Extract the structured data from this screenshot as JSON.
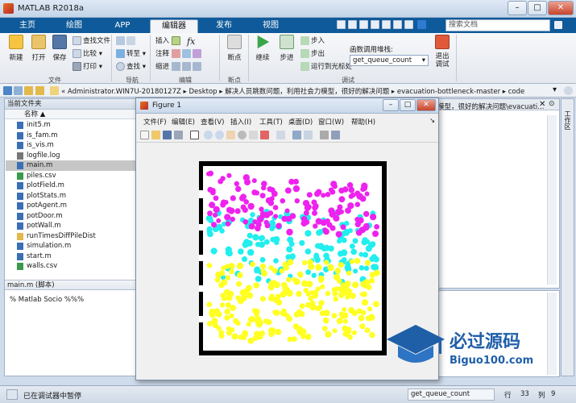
{
  "app": {
    "title": "MATLAB R2018a"
  },
  "ribbon": {
    "tabs": [
      "主页",
      "绘图",
      "APP",
      "编辑器",
      "发布",
      "视图"
    ],
    "active_tab": "编辑器",
    "search_placeholder": "搜索文档"
  },
  "toolstrip": {
    "file": {
      "new": "新建",
      "open": "打开",
      "save": "保存",
      "find_files": "查找文件",
      "compare": "比较",
      "print": "打印",
      "group": "文件"
    },
    "navigate": {
      "goto": "转至",
      "find": "查找",
      "group": "导航"
    },
    "edit": {
      "insert": "插入",
      "comment": "注释",
      "indent": "缩进",
      "fx": "fx",
      "group": "编辑"
    },
    "breakpoints": {
      "label": "断点",
      "group": "断点"
    },
    "debug": {
      "continue": "继续",
      "step": "步进",
      "step_in": "步入",
      "step_out": "步出",
      "run_to_cursor": "运行到光标处",
      "stack_label": "函数调用堆栈:",
      "stack_value": "get_queue_count",
      "quit": "退出\n调试",
      "group": "调试"
    }
  },
  "address": {
    "path": "« Administrator.WIN7U-20180127Z  ▸  Desktop  ▸  解决人员跳数问题，利用社会力模型，很好的解决问题  ▸  evacuation-bottleneck-master  ▸  code"
  },
  "current_folder": {
    "title": "当前文件夹",
    "column": "名称 ▲",
    "files": [
      {
        "name": "init5.m",
        "type": "m"
      },
      {
        "name": "is_fam.m",
        "type": "m"
      },
      {
        "name": "is_vis.m",
        "type": "m"
      },
      {
        "name": "logfile.log",
        "type": "log"
      },
      {
        "name": "main.m",
        "type": "m",
        "selected": true
      },
      {
        "name": "piles.csv",
        "type": "csv"
      },
      {
        "name": "plotField.m",
        "type": "m"
      },
      {
        "name": "plotStats.m",
        "type": "m"
      },
      {
        "name": "potAgent.m",
        "type": "m"
      },
      {
        "name": "potDoor.m",
        "type": "m"
      },
      {
        "name": "potWall.m",
        "type": "m"
      },
      {
        "name": "runTimesDiffPileDist",
        "type": "folder"
      },
      {
        "name": "simulation.m",
        "type": "m"
      },
      {
        "name": "start.m",
        "type": "m"
      },
      {
        "name": "walls.csv",
        "type": "csv"
      }
    ],
    "details_title": "main.m  (脚本)",
    "details_text": "% Matlab Socio %%%"
  },
  "editor": {
    "tab_text": "模型，很好的解决问题\\evacuati..."
  },
  "figure": {
    "title": "Figure 1",
    "menu": [
      "文件(F)",
      "编辑(E)",
      "查看(V)",
      "插入(I)",
      "工具(T)",
      "桌面(D)",
      "窗口(W)",
      "帮助(H)"
    ],
    "colors": {
      "magenta": "#ee22ee",
      "cyan": "#22eeee",
      "yellow": "#ffff22",
      "wall": "#000000"
    },
    "plot_regions": [
      {
        "color": "magenta",
        "region": "top",
        "count": 140
      },
      {
        "color": "cyan",
        "region": "middle",
        "count": 150
      },
      {
        "color": "yellow",
        "region": "bottom",
        "count": 230
      }
    ]
  },
  "status": {
    "text": "已在调试器中暂停",
    "function": "get_queue_count",
    "row_label": "行",
    "row": "33",
    "col_label": "列",
    "col": "9"
  },
  "brand": {
    "name": "必过源码",
    "url": "Biguo100.com"
  },
  "right_panel": {
    "label": "工作区"
  }
}
